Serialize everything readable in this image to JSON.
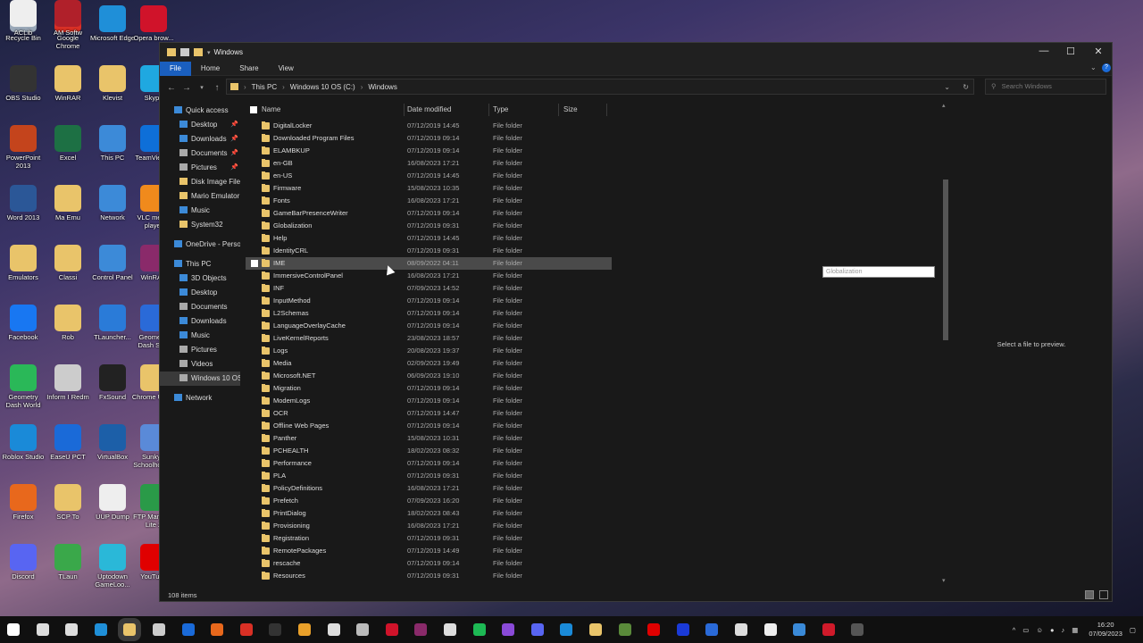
{
  "desktop": {
    "icons": [
      {
        "label": "Recycle Bin",
        "icon": "recycle-bin-icon",
        "color": "#9aa8b8"
      },
      {
        "label": "Google Chrome",
        "icon": "chrome-icon",
        "color": "#d93025"
      },
      {
        "label": "Microsoft Edge",
        "icon": "edge-icon",
        "color": "#1f8fd8"
      },
      {
        "label": "Opera brow...",
        "icon": "opera-icon",
        "color": "#d0132a"
      },
      {
        "label": "OBS Studio",
        "icon": "obs-icon",
        "color": "#333333"
      },
      {
        "label": "WinRAR",
        "icon": "folder-icon",
        "color": "#e9c46a"
      },
      {
        "label": "Klevist",
        "icon": "folder-icon",
        "color": "#e9c46a"
      },
      {
        "label": "Skype",
        "icon": "skype-icon",
        "color": "#1fa8e0"
      },
      {
        "label": "PowerPoint 2013",
        "icon": "powerpoint-icon",
        "color": "#c4441c"
      },
      {
        "label": "Excel",
        "icon": "excel-icon",
        "color": "#1d7044"
      },
      {
        "label": "This PC",
        "icon": "this-pc-icon",
        "color": "#3c8ad8"
      },
      {
        "label": "TeamViewer",
        "icon": "teamviewer-icon",
        "color": "#0e6fd8"
      },
      {
        "label": "Word 2013",
        "icon": "word-icon",
        "color": "#2b5797"
      },
      {
        "label": "Ma Emu",
        "icon": "folder-icon",
        "color": "#e9c46a"
      },
      {
        "label": "Network",
        "icon": "network-icon",
        "color": "#3c8ad8"
      },
      {
        "label": "VLC media player",
        "icon": "vlc-icon",
        "color": "#f08a1c"
      },
      {
        "label": "Emulators",
        "icon": "folder-icon",
        "color": "#e9c46a"
      },
      {
        "label": "Classi",
        "icon": "folder-icon",
        "color": "#e9c46a"
      },
      {
        "label": "Control Panel",
        "icon": "control-panel-icon",
        "color": "#3c8ad8"
      },
      {
        "label": "WinRAR",
        "icon": "winrar-icon",
        "color": "#8a2a6a"
      },
      {
        "label": "Facebook",
        "icon": "facebook-icon",
        "color": "#1877f2"
      },
      {
        "label": "Rob",
        "icon": "folder-icon",
        "color": "#e9c46a"
      },
      {
        "label": "TLauncher...",
        "icon": "tlauncher-icon",
        "color": "#2a7bd8"
      },
      {
        "label": "Geometry Dash Su...",
        "icon": "geometry-dash-icon",
        "color": "#2a6ad8"
      },
      {
        "label": "Geometry Dash World",
        "icon": "geometry-dash-world-icon",
        "color": "#2ab858"
      },
      {
        "label": "Inform I Redm",
        "icon": "folder-icon",
        "color": "#cccccc"
      },
      {
        "label": "FxSound",
        "icon": "fxsound-icon",
        "color": "#222222"
      },
      {
        "label": "Chrome Users",
        "icon": "folder-icon",
        "color": "#e9c46a"
      },
      {
        "label": "Roblox Studio",
        "icon": "roblox-studio-icon",
        "color": "#1a8ad8"
      },
      {
        "label": "EaseU PCT",
        "icon": "easeus-icon",
        "color": "#1a6ad8"
      },
      {
        "label": "VirtualBox",
        "icon": "virtualbox-icon",
        "color": "#1c5fa8"
      },
      {
        "label": "Sunky's Schoolhous...",
        "icon": "sunky-icon",
        "color": "#5a8ad8"
      },
      {
        "label": "Firefox",
        "icon": "firefox-icon",
        "color": "#e8681c"
      },
      {
        "label": "SCP To",
        "icon": "folder-icon",
        "color": "#e9c46a"
      },
      {
        "label": "UUP Dump",
        "icon": "uup-dump-icon",
        "color": "#eeeeee"
      },
      {
        "label": "FTP Manager Lite 2",
        "icon": "ftp-manager-icon",
        "color": "#2a9a48"
      },
      {
        "label": "Discord",
        "icon": "discord-icon",
        "color": "#5865f2"
      },
      {
        "label": "TLaun",
        "icon": "tlauncher-icon",
        "color": "#3aa84a"
      },
      {
        "label": "Uptodown GameLoo...",
        "icon": "uptodown-icon",
        "color": "#2ab8d8"
      },
      {
        "label": "YouTube",
        "icon": "youtube-icon",
        "color": "#e00000"
      },
      {
        "label": "ACLib",
        "icon": "file-icon",
        "color": "#eeeeee"
      },
      {
        "label": "AM Softw",
        "icon": "folder-icon",
        "color": "#b0202a"
      }
    ]
  },
  "window": {
    "title": "Windows",
    "ribbon_tabs": [
      "File",
      "Home",
      "Share",
      "View"
    ],
    "breadcrumb": [
      "This PC",
      "Windows 10 OS (C:)",
      "Windows"
    ],
    "search_placeholder": "Search Windows",
    "columns": [
      "Name",
      "Date modified",
      "Type",
      "Size"
    ],
    "rename_value": "Globalization",
    "preview_text": "Select a file to preview.",
    "status": "108 items"
  },
  "nav": {
    "items": [
      {
        "label": "Quick access",
        "icon": "star-icon",
        "color": "#3c8ad8",
        "indent": false,
        "pinned": false
      },
      {
        "label": "Desktop",
        "icon": "desktop-icon",
        "color": "#3c8ad8",
        "indent": true,
        "pinned": true
      },
      {
        "label": "Downloads",
        "icon": "downloads-icon",
        "color": "#3c8ad8",
        "indent": true,
        "pinned": true
      },
      {
        "label": "Documents",
        "icon": "documents-icon",
        "color": "#aaaaaa",
        "indent": true,
        "pinned": true
      },
      {
        "label": "Pictures",
        "icon": "pictures-icon",
        "color": "#aaaaaa",
        "indent": true,
        "pinned": true
      },
      {
        "label": "Disk Image File",
        "icon": "folder-icon",
        "color": "#e9c46a",
        "indent": true,
        "pinned": false
      },
      {
        "label": "Mario Emulator",
        "icon": "folder-icon",
        "color": "#e9c46a",
        "indent": true,
        "pinned": false
      },
      {
        "label": "Music",
        "icon": "music-icon",
        "color": "#3c8ad8",
        "indent": true,
        "pinned": false
      },
      {
        "label": "System32",
        "icon": "folder-icon",
        "color": "#e9c46a",
        "indent": true,
        "pinned": false
      },
      {
        "label": "",
        "icon": "",
        "color": "",
        "indent": false,
        "pinned": false
      },
      {
        "label": "OneDrive - Perso",
        "icon": "onedrive-icon",
        "color": "#3c8ad8",
        "indent": false,
        "pinned": false
      },
      {
        "label": "",
        "icon": "",
        "color": "",
        "indent": false,
        "pinned": false
      },
      {
        "label": "This PC",
        "icon": "this-pc-icon",
        "color": "#3c8ad8",
        "indent": false,
        "pinned": false
      },
      {
        "label": "3D Objects",
        "icon": "3d-objects-icon",
        "color": "#3c8ad8",
        "indent": true,
        "pinned": false
      },
      {
        "label": "Desktop",
        "icon": "desktop-icon",
        "color": "#3c8ad8",
        "indent": true,
        "pinned": false
      },
      {
        "label": "Documents",
        "icon": "documents-icon",
        "color": "#aaaaaa",
        "indent": true,
        "pinned": false
      },
      {
        "label": "Downloads",
        "icon": "downloads-icon",
        "color": "#3c8ad8",
        "indent": true,
        "pinned": false
      },
      {
        "label": "Music",
        "icon": "music-icon",
        "color": "#3c8ad8",
        "indent": true,
        "pinned": false
      },
      {
        "label": "Pictures",
        "icon": "pictures-icon",
        "color": "#aaaaaa",
        "indent": true,
        "pinned": false
      },
      {
        "label": "Videos",
        "icon": "videos-icon",
        "color": "#aaaaaa",
        "indent": true,
        "pinned": false
      },
      {
        "label": "Windows 10 OS",
        "icon": "drive-icon",
        "color": "#aaaaaa",
        "indent": true,
        "pinned": false,
        "selected": true
      },
      {
        "label": "",
        "icon": "",
        "color": "",
        "indent": false,
        "pinned": false
      },
      {
        "label": "Network",
        "icon": "network-icon",
        "color": "#3c8ad8",
        "indent": false,
        "pinned": false
      }
    ]
  },
  "files": [
    {
      "name": "DigitalLocker",
      "date": "07/12/2019 14:45",
      "type": "File folder"
    },
    {
      "name": "Downloaded Program Files",
      "date": "07/12/2019 09:14",
      "type": "File folder"
    },
    {
      "name": "ELAMBKUP",
      "date": "07/12/2019 09:14",
      "type": "File folder"
    },
    {
      "name": "en-GB",
      "date": "16/08/2023 17:21",
      "type": "File folder"
    },
    {
      "name": "en-US",
      "date": "07/12/2019 14:45",
      "type": "File folder"
    },
    {
      "name": "Firmware",
      "date": "15/08/2023 10:35",
      "type": "File folder"
    },
    {
      "name": "Fonts",
      "date": "16/08/2023 17:21",
      "type": "File folder"
    },
    {
      "name": "GameBarPresenceWriter",
      "date": "07/12/2019 09:14",
      "type": "File folder"
    },
    {
      "name": "Globalization",
      "date": "07/12/2019 09:31",
      "type": "File folder"
    },
    {
      "name": "Help",
      "date": "07/12/2019 14:45",
      "type": "File folder"
    },
    {
      "name": "IdentityCRL",
      "date": "07/12/2019 09:31",
      "type": "File folder"
    },
    {
      "name": "IME",
      "date": "08/09/2022 04:11",
      "type": "File folder",
      "hover": true
    },
    {
      "name": "ImmersiveControlPanel",
      "date": "16/08/2023 17:21",
      "type": "File folder"
    },
    {
      "name": "INF",
      "date": "07/09/2023 14:52",
      "type": "File folder"
    },
    {
      "name": "InputMethod",
      "date": "07/12/2019 09:14",
      "type": "File folder"
    },
    {
      "name": "L2Schemas",
      "date": "07/12/2019 09:14",
      "type": "File folder"
    },
    {
      "name": "LanguageOverlayCache",
      "date": "07/12/2019 09:14",
      "type": "File folder"
    },
    {
      "name": "LiveKernelReports",
      "date": "23/08/2023 18:57",
      "type": "File folder"
    },
    {
      "name": "Logs",
      "date": "20/08/2023 19:37",
      "type": "File folder"
    },
    {
      "name": "Media",
      "date": "02/09/2023 19:49",
      "type": "File folder"
    },
    {
      "name": "Microsoft.NET",
      "date": "06/09/2023 19:10",
      "type": "File folder"
    },
    {
      "name": "Migration",
      "date": "07/12/2019 09:14",
      "type": "File folder"
    },
    {
      "name": "ModemLogs",
      "date": "07/12/2019 09:14",
      "type": "File folder"
    },
    {
      "name": "OCR",
      "date": "07/12/2019 14:47",
      "type": "File folder"
    },
    {
      "name": "Offline Web Pages",
      "date": "07/12/2019 09:14",
      "type": "File folder"
    },
    {
      "name": "Panther",
      "date": "15/08/2023 10:31",
      "type": "File folder"
    },
    {
      "name": "PCHEALTH",
      "date": "18/02/2023 08:32",
      "type": "File folder"
    },
    {
      "name": "Performance",
      "date": "07/12/2019 09:14",
      "type": "File folder"
    },
    {
      "name": "PLA",
      "date": "07/12/2019 09:31",
      "type": "File folder"
    },
    {
      "name": "PolicyDefinitions",
      "date": "16/08/2023 17:21",
      "type": "File folder"
    },
    {
      "name": "Prefetch",
      "date": "07/09/2023 16:20",
      "type": "File folder"
    },
    {
      "name": "PrintDialog",
      "date": "18/02/2023 08:43",
      "type": "File folder"
    },
    {
      "name": "Provisioning",
      "date": "16/08/2023 17:21",
      "type": "File folder"
    },
    {
      "name": "Registration",
      "date": "07/12/2019 09:31",
      "type": "File folder"
    },
    {
      "name": "RemotePackages",
      "date": "07/12/2019 14:49",
      "type": "File folder"
    },
    {
      "name": "rescache",
      "date": "07/12/2019 09:14",
      "type": "File folder"
    },
    {
      "name": "Resources",
      "date": "07/12/2019 09:31",
      "type": "File folder"
    }
  ],
  "taskbar": {
    "icons": [
      {
        "icon": "start-icon",
        "color": "#ffffff"
      },
      {
        "icon": "search-icon",
        "color": "#dddddd"
      },
      {
        "icon": "task-view-icon",
        "color": "#dddddd"
      },
      {
        "icon": "edge-icon",
        "color": "#1f8fd8"
      },
      {
        "icon": "file-explorer-icon",
        "color": "#e9c46a"
      },
      {
        "icon": "store-icon",
        "color": "#cccccc"
      },
      {
        "icon": "outlook-icon",
        "color": "#1a6ad8"
      },
      {
        "icon": "firefox-icon",
        "color": "#e8681c"
      },
      {
        "icon": "chrome-icon",
        "color": "#d93025"
      },
      {
        "icon": "app-icon",
        "color": "#333333"
      },
      {
        "icon": "app-icon",
        "color": "#e9a02a"
      },
      {
        "icon": "settings-icon",
        "color": "#dddddd"
      },
      {
        "icon": "media-player-icon",
        "color": "#bbbbbb"
      },
      {
        "icon": "opera-icon",
        "color": "#d0132a"
      },
      {
        "icon": "winrar-icon",
        "color": "#8a2a6a"
      },
      {
        "icon": "notepad-icon",
        "color": "#dddddd"
      },
      {
        "icon": "spotify-icon",
        "color": "#1db954"
      },
      {
        "icon": "messenger-icon",
        "color": "#8a4ad8"
      },
      {
        "icon": "discord-icon",
        "color": "#5865f2"
      },
      {
        "icon": "roblox-studio-icon",
        "color": "#1a8ad8"
      },
      {
        "icon": "app-icon",
        "color": "#e9c46a"
      },
      {
        "icon": "minecraft-icon",
        "color": "#5a8a3a"
      },
      {
        "icon": "youtube-icon",
        "color": "#e00000"
      },
      {
        "icon": "app-icon",
        "color": "#1a3ad8"
      },
      {
        "icon": "calculator-icon",
        "color": "#2a6ad8"
      },
      {
        "icon": "virtualbox-icon",
        "color": "#dddddd"
      },
      {
        "icon": "github-icon",
        "color": "#eeeeee"
      },
      {
        "icon": "app-icon",
        "color": "#3a8ad8"
      },
      {
        "icon": "app-icon",
        "color": "#d01a2a"
      },
      {
        "icon": "obs-icon",
        "color": "#555555"
      }
    ],
    "time": "16:20",
    "date": "07/09/2023"
  }
}
